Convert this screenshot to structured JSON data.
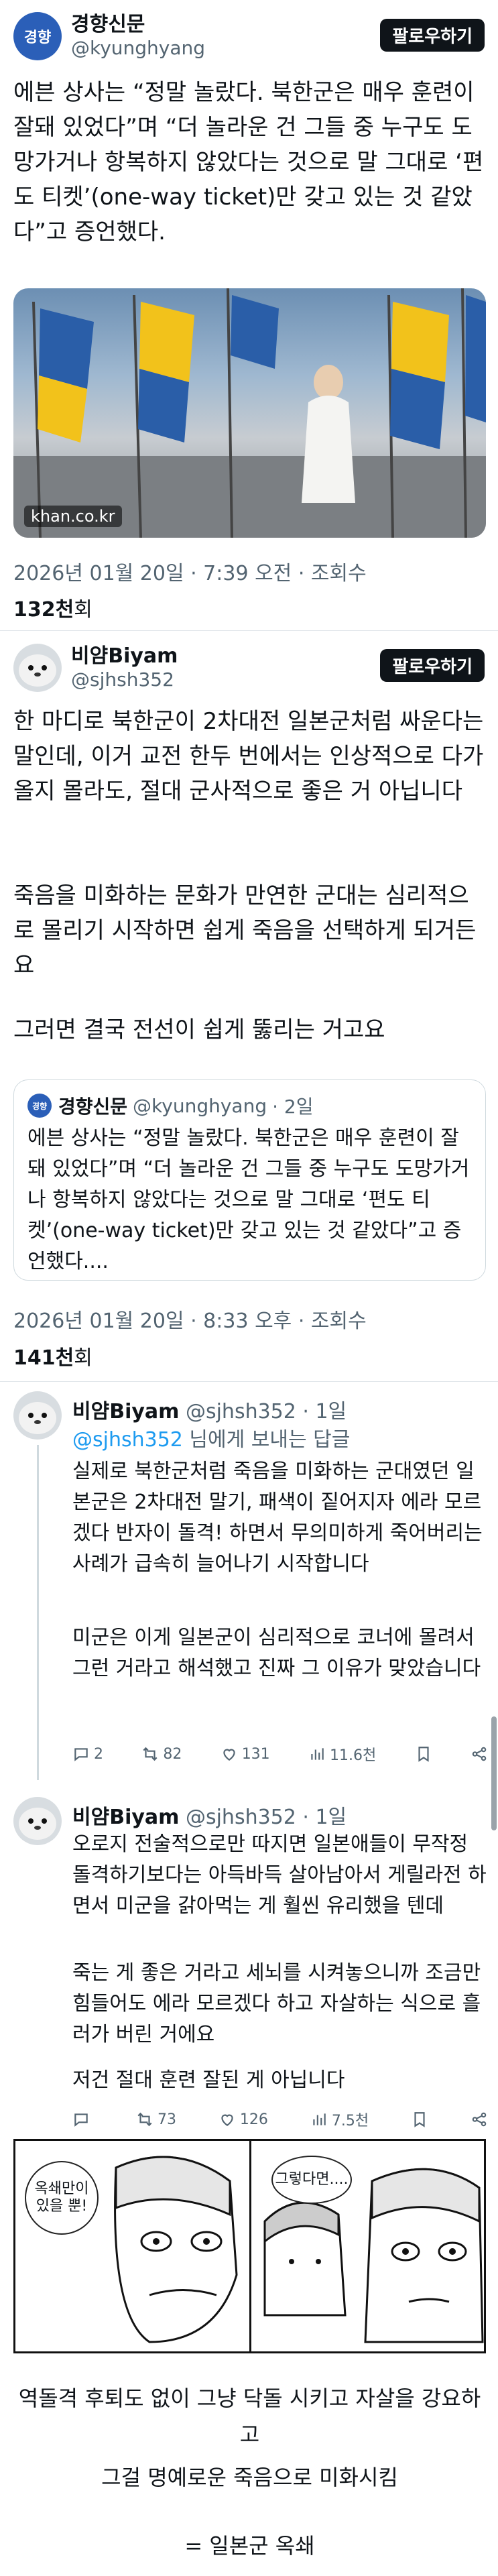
{
  "tweet1": {
    "author": "경향신문",
    "handle": "@kyunghyang",
    "avatar_text": "경향",
    "follow_label": "팔로우하기",
    "text": "에븐 상사는 “정말 놀랐다. 북한군은 매우 훈련이 잘돼 있었다”며 “더 놀라운 건 그들 중 누구도 도망가거나 항복하지 않았다는 것으로 말 그대로 ‘편도 티켓’(one-way ticket)만 갖고 있는 것 같았다”고 증언했다.",
    "link_domain": "khan.co.kr",
    "date": "2026년 01월 20일 · 7:39 오전 · 조회수",
    "views_count": "132천",
    "views_suffix": "회"
  },
  "tweet2": {
    "author": "비얌Biyam",
    "handle": "@sjhsh352",
    "follow_label": "팔로우하기",
    "paragraphs": [
      "한 마디로 북한군이 2차대전 일본군처럼 싸운다는 말인데, 이거 교전 한두 번에서는 인상적으로 다가올지 몰라도, 절대 군사적으로 좋은 거 아닙니다",
      "죽음을 미화하는 문화가 만연한 군대는 심리적으로 몰리기 시작하면 쉽게 죽음을 선택하게 되거든요",
      "그러면 결국 전선이 쉽게 뚫리는 거고요"
    ],
    "quote": {
      "author": "경향신문",
      "handle": "@kyunghyang",
      "time": "· 2일",
      "avatar_text": "경향",
      "text": "에븐 상사는 “정말 놀랐다. 북한군은 매우 훈련이 잘돼 있었다”며 “더 놀라운 건 그들 중 누구도 도망가거나 항복하지 않았다는 것으로 말 그대로 ‘편도 티켓’(one-way ticket)만 갖고 있는 것 같았다”고 증언했다...."
    },
    "date": "2026년 01월 20일 · 8:33 오후 · 조회수",
    "views_count": "141천",
    "views_suffix": "회"
  },
  "reply1": {
    "author": "비얌Biyam",
    "handle": "@sjhsh352 · 1일",
    "replying_prefix": "",
    "mention": "@sjhsh352",
    "replying_suffix": " 님에게 보내는 답글",
    "paragraphs": [
      "실제로 북한군처럼 죽음을 미화하는 군대였던 일본군은 2차대전 말기, 패색이 짙어지자 에라 모르겠다 반자이 돌격! 하면서 무의미하게 죽어버리는 사례가 급속히 늘어나기 시작합니다",
      "미군은 이게 일본군이 심리적으로 코너에 몰려서 그런 거라고 해석했고 진짜 그 이유가 맞았습니다"
    ],
    "replies": "2",
    "retweets": "82",
    "likes": "131",
    "views": "11.6천"
  },
  "reply2": {
    "author": "비얌Biyam",
    "handle": "@sjhsh352 · 1일",
    "paragraphs": [
      "오로지 전술적으로만 따지면 일본애들이 무작정 돌격하기보다는 아득바득 살아남아서 게릴라전 하면서 미군을 갉아먹는 게 훨씬 유리했을 텐데",
      "죽는 게 좋은 거라고 세뇌를 시켜놓으니까 조금만 힘들어도 에라 모르겠다 하고 자살하는 식으로 흘러가 버린 거에요",
      "저건 절대 훈련 잘된 게 아닙니다"
    ],
    "replies": "",
    "retweets": "73",
    "likes": "126",
    "views": "7.5천"
  },
  "comic": {
    "bubble1": "옥쇄만이 있을 뿐!",
    "bubble2": "그렇다면...."
  },
  "bottom": {
    "line1": "역돌격 후퇴도 없이 그냥 닥돌 시키고 자살을 강요하고",
    "line2": "그걸 명예로운 죽음으로 미화시킴",
    "line3": "= 일본군 옥쇄"
  },
  "colors": {
    "link": "#1d9bf0",
    "muted": "#536471",
    "button": "#0f1419",
    "khan_blue": "#2b5fb8"
  }
}
